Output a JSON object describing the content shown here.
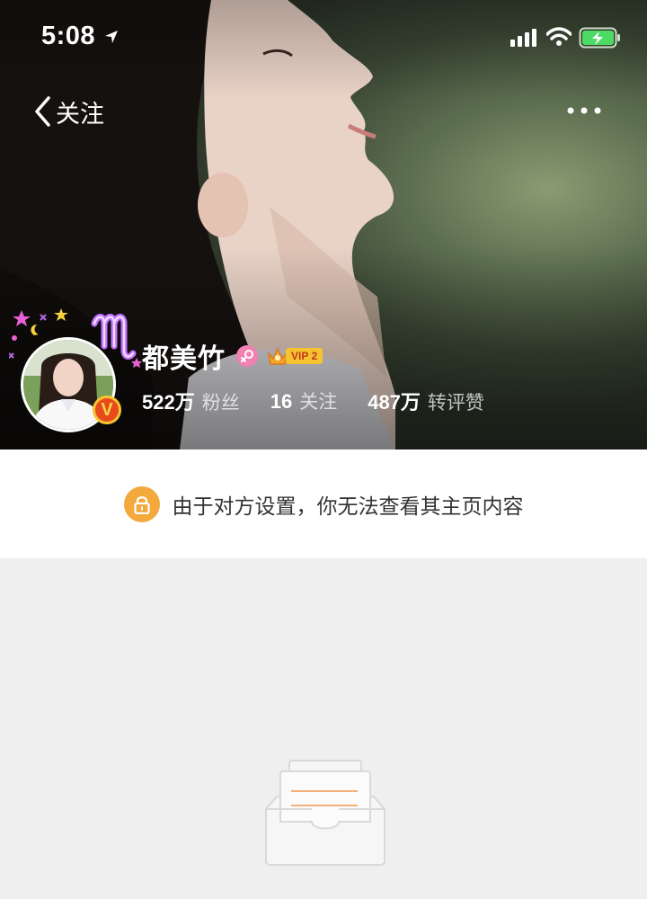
{
  "status_bar": {
    "time": "5:08"
  },
  "nav": {
    "back_label": "关注"
  },
  "profile": {
    "name": "都美竹",
    "vip_label": "VIP 2",
    "verified_badge": "V",
    "stats": [
      {
        "value": "522万",
        "label": "粉丝"
      },
      {
        "value": "16",
        "label": "关注"
      },
      {
        "value": "487万",
        "label": "转评赞"
      }
    ]
  },
  "notice": {
    "text": "由于对方设置，你无法查看其主页内容"
  },
  "colors": {
    "accent_orange": "#f3a93c",
    "gender_pink": "#f180b3",
    "vip_gold": "#f5c230",
    "background": "#efefef"
  }
}
